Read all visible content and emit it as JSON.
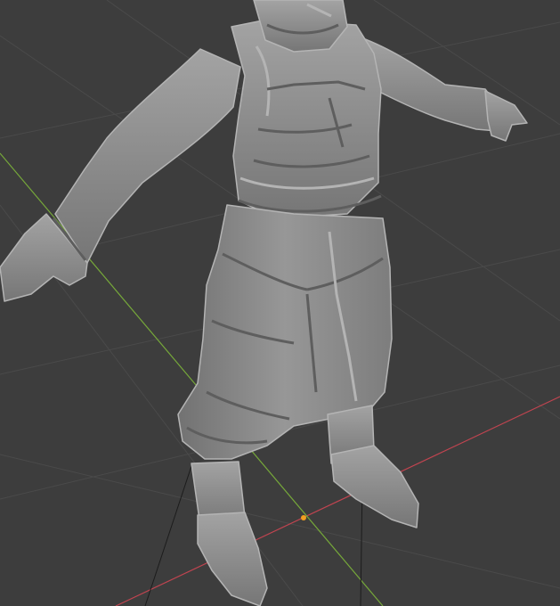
{
  "viewport": {
    "background_color": "#3d3d3d",
    "grid_color": "#4a4a4a",
    "x_axis_color": "#c04450",
    "y_axis_color": "#76a83a",
    "origin_color": "#f0a020"
  },
  "model": {
    "base_color": "#8a8a8a",
    "highlight_color": "#b4b4b4",
    "shadow_color": "#5e5e5e",
    "outline_color": "#2f2f2f"
  }
}
